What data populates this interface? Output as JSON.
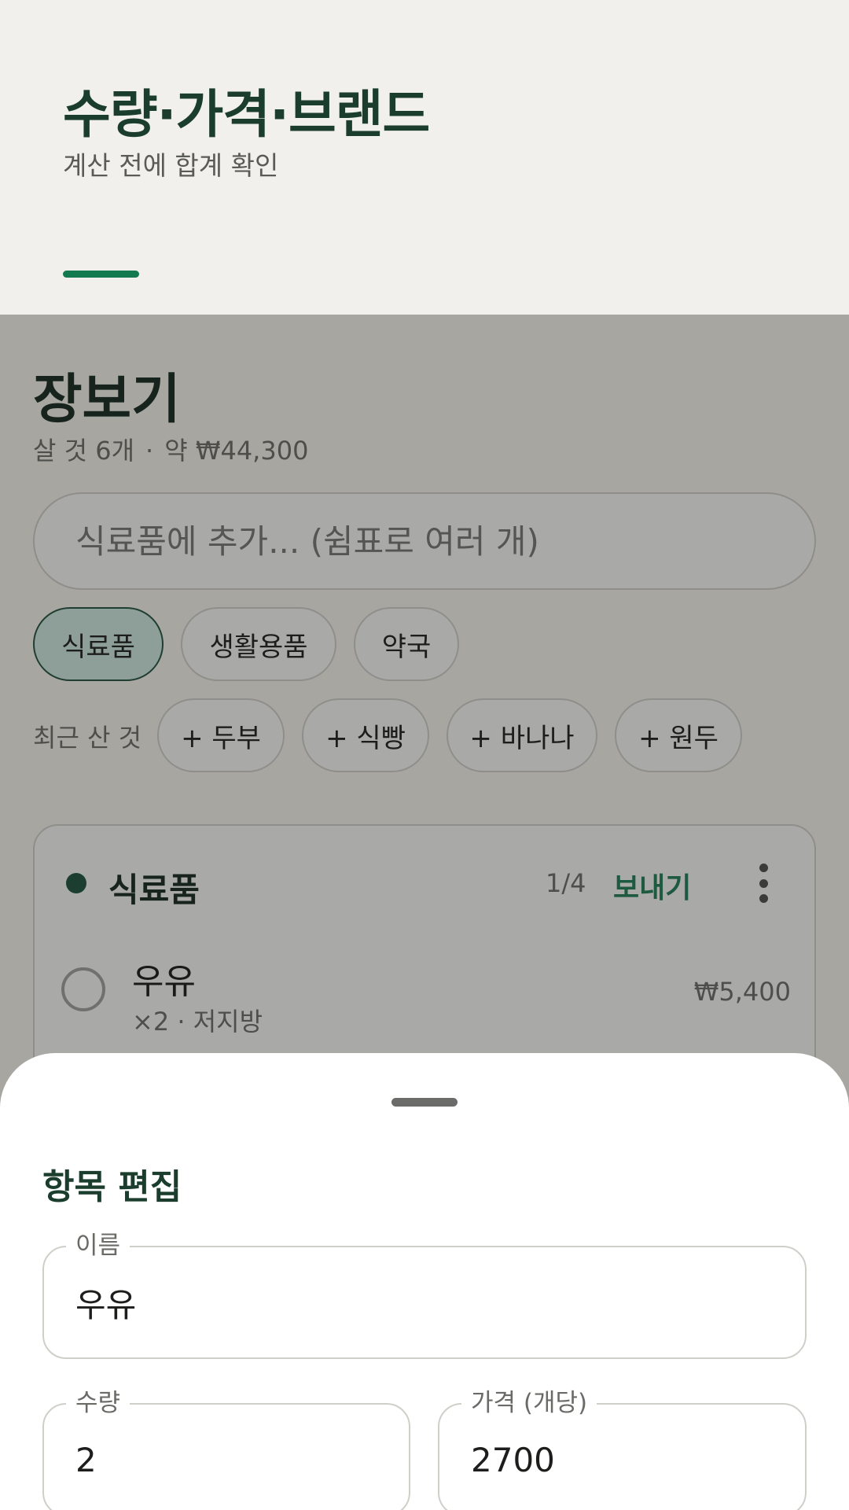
{
  "promo": {
    "title": "수량·가격·브랜드",
    "subtitle": "계산 전에 합계 확인"
  },
  "app": {
    "title": "장보기",
    "count_text": "살 것 6개",
    "separator": "·",
    "total_text": "약 ₩44,300",
    "add_placeholder": "식료품에 추가... (쉼표로 여러 개)",
    "categories": [
      {
        "label": "식료품",
        "active": true
      },
      {
        "label": "생활용품",
        "active": false
      },
      {
        "label": "약국",
        "active": false
      }
    ],
    "recent_label": "최근 산 것",
    "recent_items": [
      "+ 두부",
      "+ 식빵",
      "+ 바나나",
      "+ 원두"
    ],
    "list_card": {
      "name": "식료품",
      "count": "1/4",
      "send_label": "보내기",
      "items": [
        {
          "name": "우유",
          "detail": "×2 · 저지방",
          "price": "₩5,400"
        }
      ]
    }
  },
  "sheet": {
    "title": "항목 편집",
    "name_label": "이름",
    "name_value": "우유",
    "qty_label": "수량",
    "qty_value": "2",
    "price_label": "가격 (개당)",
    "price_value": "2700"
  },
  "colors": {
    "accent": "#137a4f",
    "dark_green": "#1a3d2e",
    "scrim": "#a7a6a1"
  }
}
